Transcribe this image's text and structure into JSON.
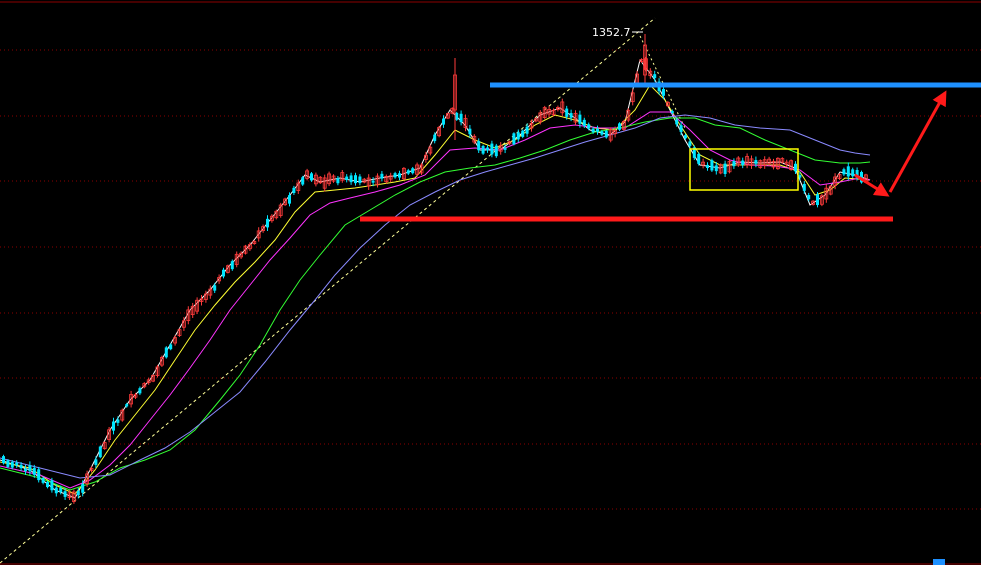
{
  "chart_data": {
    "type": "candlestick",
    "annotations": {
      "peak_label": "1352.7",
      "peak_value": 1352.7
    },
    "colors": {
      "background": "#000000",
      "grid": "#8b0000",
      "up_candle": "#ff3b3b",
      "down_candle": "#00e5ff",
      "ma5": "#ffffff",
      "ma10": "#ffff33",
      "ma20": "#ff33ff",
      "ma30": "#33ff33",
      "ma60": "#8a8aff",
      "resistance_line": "#1e90ff",
      "support_line": "#ff1a1a",
      "consolidation_box": "#ffff00",
      "arrow": "#ff1a1a",
      "trendline": "#ffff99"
    },
    "series": [
      {
        "key": "ma5",
        "points": [
          [
            0,
            460
          ],
          [
            30,
            470
          ],
          [
            55,
            490
          ],
          [
            75,
            498
          ],
          [
            90,
            470
          ],
          [
            110,
            430
          ],
          [
            130,
            400
          ],
          [
            150,
            380
          ],
          [
            170,
            345
          ],
          [
            190,
            310
          ],
          [
            210,
            290
          ],
          [
            230,
            265
          ],
          [
            250,
            245
          ],
          [
            270,
            220
          ],
          [
            290,
            195
          ],
          [
            305,
            175
          ],
          [
            320,
            182
          ],
          [
            340,
            178
          ],
          [
            360,
            182
          ],
          [
            380,
            178
          ],
          [
            400,
            175
          ],
          [
            420,
            168
          ],
          [
            435,
            135
          ],
          [
            450,
            110
          ],
          [
            465,
            125
          ],
          [
            480,
            150
          ],
          [
            500,
            150
          ],
          [
            520,
            135
          ],
          [
            540,
            115
          ],
          [
            560,
            108
          ],
          [
            575,
            118
          ],
          [
            590,
            130
          ],
          [
            610,
            135
          ],
          [
            625,
            122
          ],
          [
            640,
            60
          ],
          [
            655,
            80
          ],
          [
            670,
            110
          ],
          [
            685,
            140
          ],
          [
            700,
            165
          ],
          [
            720,
            168
          ],
          [
            740,
            162
          ],
          [
            760,
            163
          ],
          [
            780,
            162
          ],
          [
            795,
            168
          ],
          [
            810,
            205
          ],
          [
            825,
            195
          ],
          [
            840,
            172
          ],
          [
            855,
            175
          ],
          [
            870,
            180
          ]
        ]
      },
      {
        "key": "ma10",
        "points": [
          [
            0,
            462
          ],
          [
            30,
            468
          ],
          [
            55,
            485
          ],
          [
            75,
            494
          ],
          [
            95,
            470
          ],
          [
            115,
            440
          ],
          [
            135,
            415
          ],
          [
            155,
            390
          ],
          [
            175,
            360
          ],
          [
            195,
            330
          ],
          [
            215,
            305
          ],
          [
            235,
            282
          ],
          [
            255,
            262
          ],
          [
            275,
            240
          ],
          [
            295,
            212
          ],
          [
            315,
            192
          ],
          [
            335,
            190
          ],
          [
            355,
            188
          ],
          [
            375,
            185
          ],
          [
            395,
            182
          ],
          [
            415,
            178
          ],
          [
            435,
            155
          ],
          [
            455,
            130
          ],
          [
            475,
            140
          ],
          [
            495,
            148
          ],
          [
            515,
            140
          ],
          [
            535,
            125
          ],
          [
            555,
            115
          ],
          [
            575,
            120
          ],
          [
            595,
            128
          ],
          [
            615,
            130
          ],
          [
            635,
            110
          ],
          [
            650,
            85
          ],
          [
            665,
            100
          ],
          [
            680,
            125
          ],
          [
            700,
            155
          ],
          [
            720,
            165
          ],
          [
            740,
            165
          ],
          [
            760,
            165
          ],
          [
            780,
            165
          ],
          [
            800,
            172
          ],
          [
            815,
            195
          ],
          [
            830,
            190
          ],
          [
            845,
            178
          ],
          [
            870,
            180
          ]
        ]
      },
      {
        "key": "ma20",
        "points": [
          [
            0,
            466
          ],
          [
            40,
            475
          ],
          [
            70,
            488
          ],
          [
            90,
            480
          ],
          [
            110,
            465
          ],
          [
            130,
            445
          ],
          [
            150,
            420
          ],
          [
            170,
            395
          ],
          [
            190,
            368
          ],
          [
            210,
            340
          ],
          [
            230,
            310
          ],
          [
            250,
            285
          ],
          [
            270,
            260
          ],
          [
            290,
            238
          ],
          [
            310,
            215
          ],
          [
            330,
            203
          ],
          [
            350,
            198
          ],
          [
            375,
            192
          ],
          [
            400,
            185
          ],
          [
            425,
            175
          ],
          [
            450,
            150
          ],
          [
            475,
            148
          ],
          [
            500,
            150
          ],
          [
            525,
            140
          ],
          [
            550,
            128
          ],
          [
            575,
            125
          ],
          [
            600,
            128
          ],
          [
            625,
            128
          ],
          [
            650,
            112
          ],
          [
            670,
            112
          ],
          [
            690,
            130
          ],
          [
            710,
            150
          ],
          [
            730,
            160
          ],
          [
            750,
            165
          ],
          [
            775,
            166
          ],
          [
            800,
            170
          ],
          [
            820,
            185
          ],
          [
            840,
            182
          ],
          [
            860,
            178
          ],
          [
            870,
            180
          ]
        ]
      },
      {
        "key": "ma30",
        "points": [
          [
            0,
            468
          ],
          [
            40,
            478
          ],
          [
            70,
            490
          ],
          [
            95,
            482
          ],
          [
            120,
            468
          ],
          [
            145,
            460
          ],
          [
            170,
            450
          ],
          [
            195,
            430
          ],
          [
            220,
            400
          ],
          [
            240,
            375
          ],
          [
            260,
            345
          ],
          [
            280,
            310
          ],
          [
            300,
            280
          ],
          [
            320,
            255
          ],
          [
            345,
            225
          ],
          [
            370,
            210
          ],
          [
            395,
            195
          ],
          [
            420,
            182
          ],
          [
            445,
            172
          ],
          [
            470,
            168
          ],
          [
            495,
            165
          ],
          [
            520,
            158
          ],
          [
            545,
            150
          ],
          [
            570,
            140
          ],
          [
            595,
            132
          ],
          [
            620,
            128
          ],
          [
            645,
            122
          ],
          [
            670,
            118
          ],
          [
            695,
            118
          ],
          [
            715,
            125
          ],
          [
            740,
            128
          ],
          [
            765,
            140
          ],
          [
            790,
            150
          ],
          [
            815,
            160
          ],
          [
            840,
            163
          ],
          [
            860,
            163
          ],
          [
            870,
            162
          ]
        ]
      },
      {
        "key": "ma60",
        "points": [
          [
            0,
            458
          ],
          [
            40,
            468
          ],
          [
            80,
            478
          ],
          [
            110,
            475
          ],
          [
            140,
            460
          ],
          [
            165,
            448
          ],
          [
            190,
            432
          ],
          [
            215,
            412
          ],
          [
            240,
            392
          ],
          [
            265,
            362
          ],
          [
            290,
            330
          ],
          [
            315,
            300
          ],
          [
            335,
            275
          ],
          [
            360,
            248
          ],
          [
            385,
            225
          ],
          [
            410,
            205
          ],
          [
            435,
            192
          ],
          [
            460,
            180
          ],
          [
            485,
            172
          ],
          [
            510,
            165
          ],
          [
            535,
            158
          ],
          [
            560,
            150
          ],
          [
            585,
            142
          ],
          [
            610,
            135
          ],
          [
            635,
            128
          ],
          [
            660,
            118
          ],
          [
            685,
            115
          ],
          [
            710,
            118
          ],
          [
            735,
            125
          ],
          [
            760,
            128
          ],
          [
            790,
            130
          ],
          [
            815,
            140
          ],
          [
            840,
            150
          ],
          [
            855,
            153
          ],
          [
            870,
            155
          ]
        ]
      }
    ],
    "trendline": [
      [
        0,
        563
      ],
      [
        655,
        18
      ]
    ],
    "resistance_line": [
      [
        490,
        85
      ],
      [
        981,
        85
      ]
    ],
    "support_line": [
      [
        360,
        219
      ],
      [
        893,
        219
      ]
    ],
    "consolidation_box": [
      [
        690,
        149
      ],
      [
        798,
        190
      ]
    ],
    "arrows": [
      {
        "from": [
          855,
          175
        ],
        "to": [
          887,
          195
        ]
      },
      {
        "from": [
          890,
          192
        ],
        "to": [
          945,
          93
        ]
      }
    ]
  }
}
